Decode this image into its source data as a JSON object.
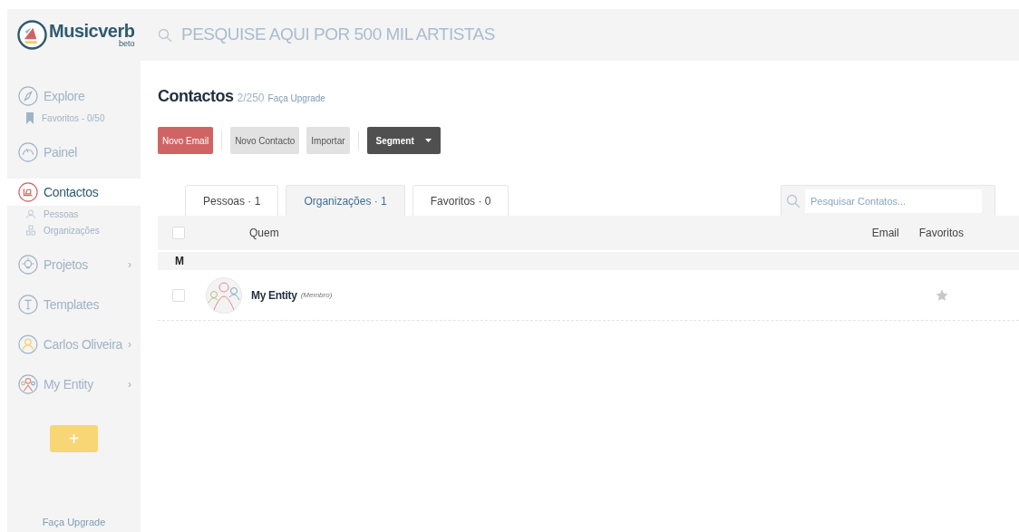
{
  "brand": {
    "name": "Musicverb",
    "tag": "beto"
  },
  "search": {
    "placeholder": "PESQUISE AQUI POR 500 MIL ARTISTAS"
  },
  "sidebar": {
    "items": [
      {
        "label": "Explore",
        "kind": "compass",
        "selected": false,
        "children": [
          {
            "label": "Favoritos - 0/50",
            "kind": "bookmark"
          }
        ]
      },
      {
        "label": "Painel",
        "kind": "gauge",
        "selected": false
      },
      {
        "label": "Contactos",
        "kind": "contacts",
        "selected": true,
        "children": [
          {
            "label": "Pessoas",
            "kind": "person"
          },
          {
            "label": "Organizações",
            "kind": "org"
          }
        ]
      },
      {
        "label": "Projetos",
        "kind": "bulb",
        "selected": false,
        "chevron": "›"
      },
      {
        "label": "Templates",
        "kind": "template",
        "selected": false
      },
      {
        "label": "Carlos Oliveira",
        "kind": "user",
        "selected": false,
        "chevron": "›"
      },
      {
        "label": "My Entity",
        "kind": "group",
        "selected": false,
        "chevron": "›"
      }
    ],
    "add_button": "+",
    "upgrade_link": "Faça Upgrade"
  },
  "header": {
    "title": "Contactos",
    "count": "2/250",
    "upgrade_link": "Faça Upgrade"
  },
  "buttons": [
    {
      "label": "Novo Email",
      "kind": "primary"
    },
    {
      "label": "Novo Contacto",
      "kind": "secondary"
    },
    {
      "label": "Importar",
      "kind": "secondary"
    },
    {
      "label": "Segment",
      "kind": "dropdown"
    }
  ],
  "tabs": [
    {
      "label": "Pessoas · 1",
      "selected": false
    },
    {
      "label": "Organizações · 1",
      "selected": true
    },
    {
      "label": "Favoritos · 0",
      "selected": false
    }
  ],
  "contact_search": {
    "placeholder": "Pesquisar Contatos..."
  },
  "table": {
    "select_all": {
      "checked": false
    },
    "columns": [
      "Quem",
      "Email",
      "Favoritos"
    ],
    "groups": [
      {
        "letter": "M",
        "rows": [
          {
            "name": "My Entity",
            "role": "(Membro)",
            "checked": false,
            "favorite": false
          }
        ]
      }
    ]
  }
}
